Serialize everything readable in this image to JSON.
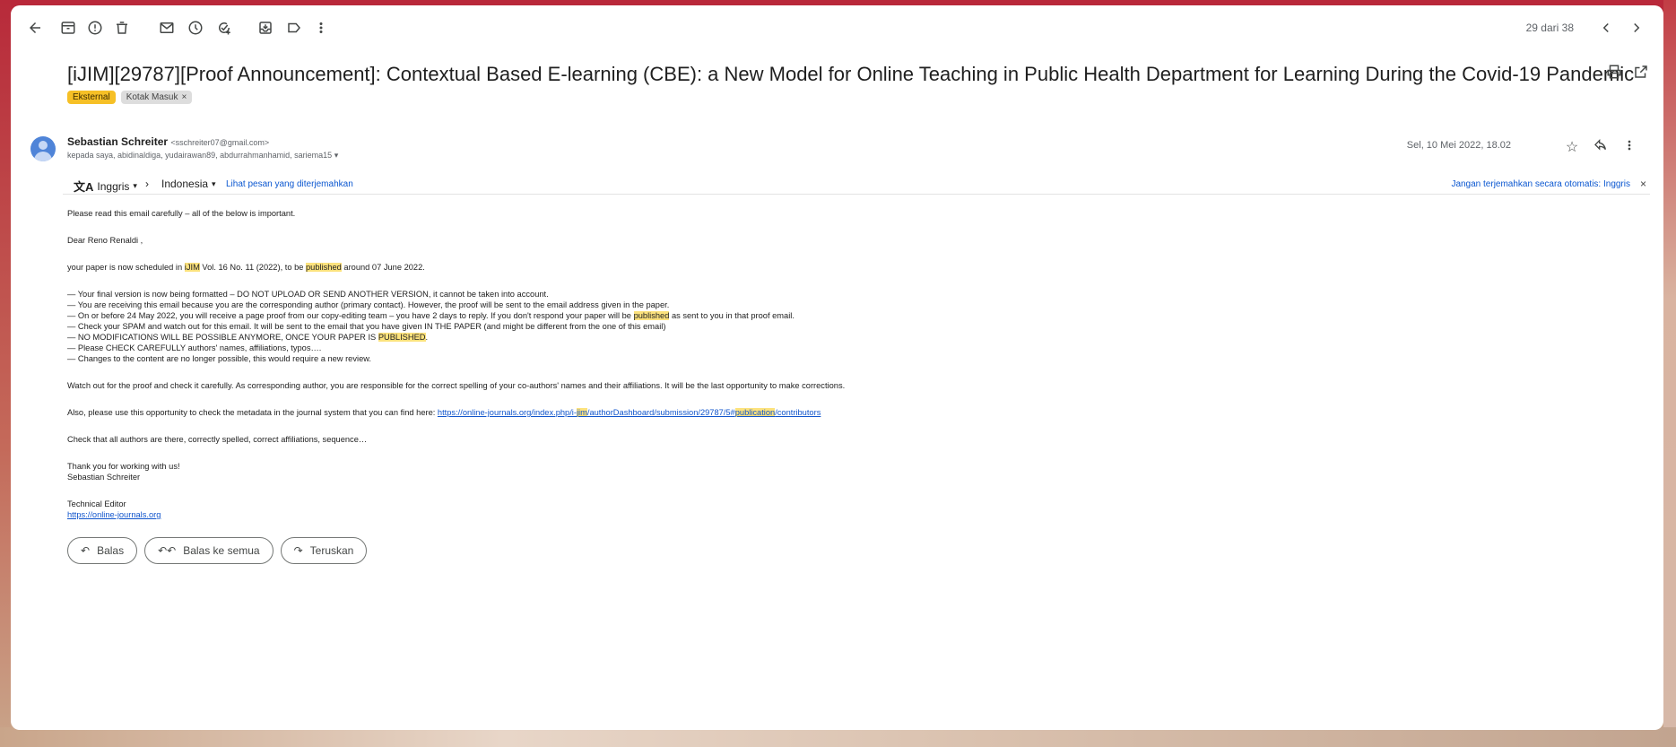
{
  "toolbar": {
    "icons": [
      "back-icon",
      "archive-icon",
      "report-spam-icon",
      "delete-icon",
      "mark-unread-icon",
      "snooze-icon",
      "add-to-tasks-icon",
      "move-to-icon",
      "label-icon",
      "more-icon"
    ],
    "pager": "29 dari 38"
  },
  "email": {
    "subject": "[iJIM][29787][Proof Announcement]: Contextual Based E-learning (CBE): a New Model for Online Teaching in Public Health Department for Learning During the Covid-19 Pandemic",
    "label_external": "Eksternal",
    "label_inbox": "Kotak Masuk",
    "label_inbox_close": "×",
    "sender_name": "Sebastian Schreiter",
    "sender_email": "<sschreiter07@gmail.com>",
    "recipients": "kepada saya, abidinaldiga, yudairawan89, abdurrahmanhamid, sariema15",
    "date": "Sel, 10 Mei 2022, 18.02"
  },
  "translate": {
    "from": "Inggris",
    "to": "Indonesia",
    "view_translated": "Lihat pesan yang diterjemahkan",
    "dont_translate": "Jangan terjemahkan secara otomatis: Inggris",
    "close": "×"
  },
  "body": {
    "l1": "Please read this email carefully – all of the below is important.",
    "l2": "Dear Reno Renaldi ,",
    "l3a": "your paper is now scheduled in ",
    "l3b": "iJIM",
    "l3c": " Vol. 16 No. 11 (2022), to be ",
    "l3d": "published",
    "l3e": " around 07 June 2022.",
    "b1": " — Your final version is now being formatted – DO NOT UPLOAD OR SEND ANOTHER VERSION, it cannot be taken into account.",
    "b2": " — You are receiving this email because you are the corresponding author (primary contact). However, the proof will be sent to the email address given in the paper.",
    "b3a": " — On or before 24 May 2022, you will receive a page proof from our copy-editing team – you have 2 days to reply. If you don't respond your paper will be ",
    "b3b": "published",
    "b3c": " as sent to you in that proof email.",
    "b4": " — Check your SPAM and watch out for this email. It will be sent to the email that you have given IN THE PAPER (and might be different from the one of this email)",
    "b5a": " — NO MODIFICATIONS WILL BE POSSIBLE ANYMORE, ONCE YOUR PAPER IS ",
    "b5b": "PUBLISHED",
    "b5c": ".",
    "b6": " — Please CHECK CAREFULLY authors' names, affiliations, typos….",
    "b7": " — Changes to the content are no longer possible, this would require a new review.",
    "l4": "Watch out for the proof and check it carefully. As corresponding author, you are responsible for the correct spelling of your co-authors' names and their affiliations. It will be the last opportunity to make corrections.",
    "l5a": "Also, please use this opportunity to check the metadata in the journal system that you can find here:  ",
    "l5b": "https://online-journals.org/index.php/i-",
    "l5c": "jim",
    "l5d": "/authorDashboard/submission/29787/5#",
    "l5e": "publication",
    "l5f": "/contributors",
    "l6": "Check that all authors are there, correctly spelled, correct affiliations, sequence…",
    "l7": "Thank you for working with us!",
    "l8": "Sebastian Schreiter",
    "l9": "Technical Editor",
    "l10": "https://online-journals.org"
  },
  "actions": {
    "reply": "Balas",
    "reply_all": "Balas ke semua",
    "forward": "Teruskan"
  },
  "colors": {
    "highlight": "#fce27d",
    "link": "#1155cc",
    "label_external": "#f6c026"
  }
}
